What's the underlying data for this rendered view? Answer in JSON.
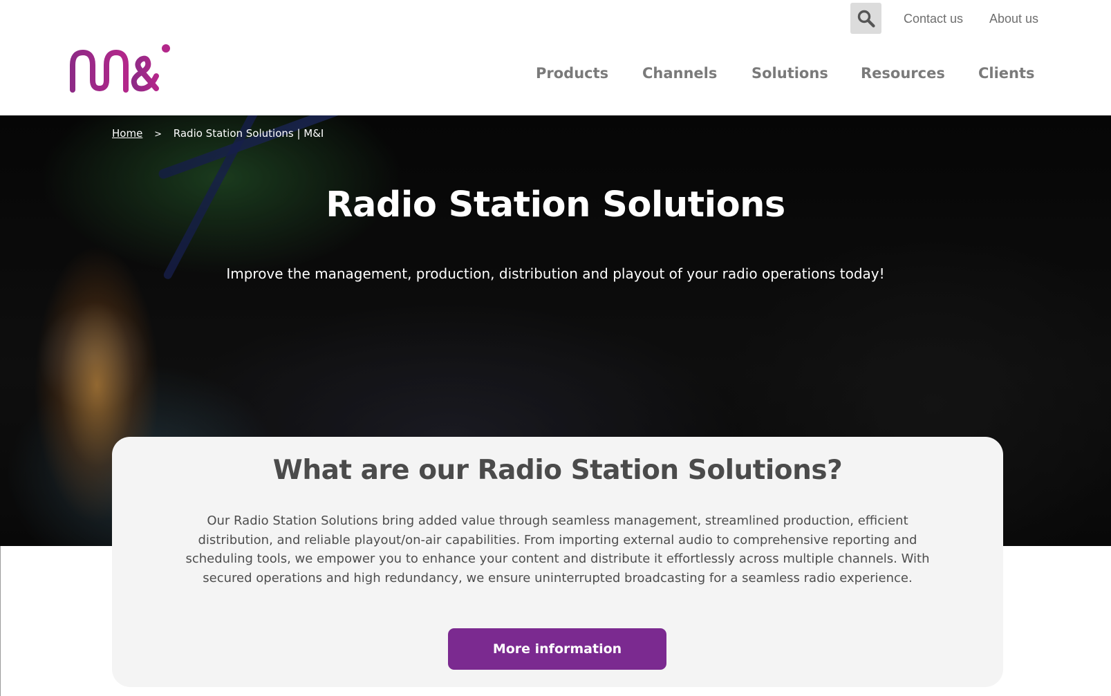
{
  "header": {
    "logo_text": "m&i",
    "top_links": [
      "Contact us",
      "About us"
    ],
    "nav": [
      "Products",
      "Channels",
      "Solutions",
      "Resources",
      "Clients"
    ]
  },
  "breadcrumb": {
    "home": "Home",
    "separator": ">",
    "current": "Radio Station Solutions | M&I"
  },
  "hero": {
    "title": "Radio Station Solutions",
    "subtitle": "Improve the management, production, distribution and playout of your radio operations today!"
  },
  "card": {
    "title": "What are our Radio Station Solutions?",
    "body": "Our Radio Station Solutions bring added value through seamless management, streamlined production, efficient distribution, and reliable playout/on-air capabilities. From importing external audio to comprehensive reporting and scheduling tools, we empower you to enhance your content and distribute it effortlessly across multiple channels. With secured operations and high redundancy, we ensure uninterrupted broadcasting for a seamless radio experience.",
    "button": "More information"
  },
  "icons": {
    "search": "search-icon",
    "logo": "mi-logo-icon"
  },
  "colors": {
    "brand_purple": "#7b2a90",
    "logo_gradient_start": "#8e2a86",
    "logo_gradient_end": "#b3278a",
    "nav_text": "#7a7a7a",
    "card_bg": "#f4f4f4",
    "search_bg": "#dcdcdc"
  }
}
